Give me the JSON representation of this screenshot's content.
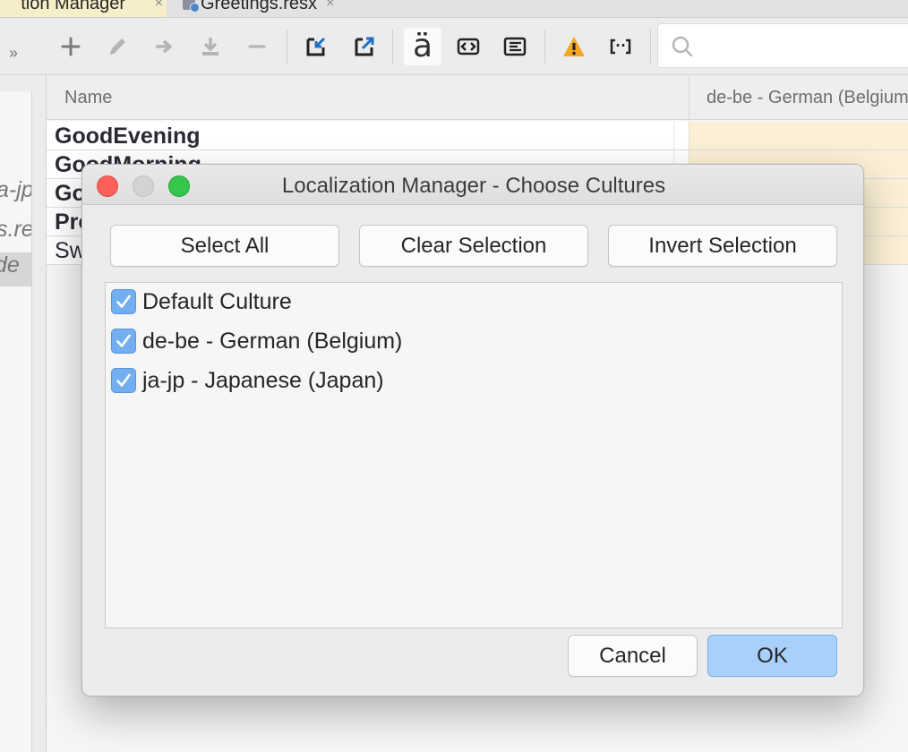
{
  "tabs": [
    {
      "label": "tion Manager",
      "close": "×"
    },
    {
      "label": "Greetings.resx",
      "close": "×"
    }
  ],
  "toolbar": {
    "more": "››",
    "umlaut": "ä",
    "search": {
      "placeholder": "",
      "value": ""
    }
  },
  "left_panel": {
    "items": [
      "a-jp",
      "s.re",
      "de"
    ]
  },
  "grid": {
    "columns": [
      "Name",
      "de-be - German (Belgium)"
    ],
    "rows": [
      {
        "name": "GoodEvening",
        "bold": true
      },
      {
        "name": "GoodMorning",
        "bold": true
      },
      {
        "name": "Go",
        "bold": true
      },
      {
        "name": "Pro",
        "bold": true
      },
      {
        "name": "Sw",
        "bold": false
      }
    ]
  },
  "dialog": {
    "title": "Localization Manager - Choose Cultures",
    "buttons": {
      "select_all": "Select All",
      "clear_selection": "Clear Selection",
      "invert_selection": "Invert Selection",
      "cancel": "Cancel",
      "ok": "OK"
    },
    "cultures": [
      {
        "label": "Default Culture",
        "checked": true
      },
      {
        "label": "de-be - German (Belgium)",
        "checked": true
      },
      {
        "label": "ja-jp - Japanese (Japan)",
        "checked": true
      }
    ]
  },
  "colors": {
    "accent": "#73aef0",
    "ok_button": "#a7d0fb",
    "warning": "#f5a623",
    "translation_cell": "#fbf0d6",
    "close_light": "#fc605b",
    "max_light": "#35c64a"
  },
  "icons": [
    "plus-icon",
    "pencil-icon",
    "arrow-right-icon",
    "download-icon",
    "minus-icon",
    "import-icon",
    "export-icon",
    "umlaut-icon",
    "code-braces-icon",
    "text-align-icon",
    "warning-icon",
    "quote-brackets-icon",
    "search-icon",
    "checkmark-icon"
  ]
}
